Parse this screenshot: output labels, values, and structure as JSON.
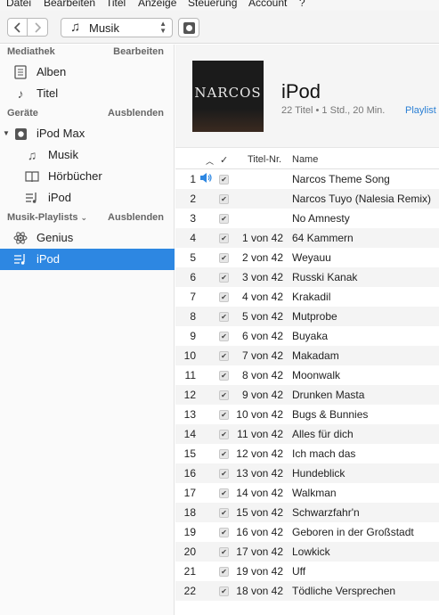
{
  "menu": [
    "Datei",
    "Bearbeiten",
    "Titel",
    "Anzeige",
    "Steuerung",
    "Account",
    "?"
  ],
  "toolbar": {
    "media_type": "Musik"
  },
  "sidebar": {
    "library_title": "Mediathek",
    "library_action": "Bearbeiten",
    "library_items": [
      {
        "label": "Alben",
        "icon": "album-icon"
      },
      {
        "label": "Titel",
        "icon": "music-note-icon"
      }
    ],
    "devices_title": "Geräte",
    "devices_action": "Ausblenden",
    "device_name": "iPod Max",
    "device_items": [
      {
        "label": "Musik",
        "icon": "music-note-icon"
      },
      {
        "label": "Hörbücher",
        "icon": "book-icon"
      },
      {
        "label": "iPod",
        "icon": "playlist-icon"
      }
    ],
    "playlists_title": "Musik-Playlists",
    "playlists_action": "Ausblenden",
    "playlist_items": [
      {
        "label": "Genius",
        "icon": "genius-atom-icon"
      },
      {
        "label": "iPod",
        "icon": "playlist-icon",
        "selected": true
      }
    ]
  },
  "header": {
    "cover_text": "NARCOS",
    "title": "iPod",
    "subtitle": "22 Titel • 1 Std., 20 Min.",
    "link": "Playlist"
  },
  "table": {
    "col_check": "✓",
    "col_track_nr": "Titel-Nr.",
    "col_name": "Name",
    "rows": [
      {
        "n": "1",
        "nr": "",
        "name": "Narcos Theme Song",
        "playing": true
      },
      {
        "n": "2",
        "nr": "",
        "name": "Narcos Tuyo (Nalesia Remix)"
      },
      {
        "n": "3",
        "nr": "",
        "name": "No Amnesty"
      },
      {
        "n": "4",
        "nr": "1 von 42",
        "name": "64 Kammern"
      },
      {
        "n": "5",
        "nr": "2 von 42",
        "name": "Weyauu"
      },
      {
        "n": "6",
        "nr": "3 von 42",
        "name": "Russki Kanak"
      },
      {
        "n": "7",
        "nr": "4 von 42",
        "name": "Krakadil"
      },
      {
        "n": "8",
        "nr": "5 von 42",
        "name": "Mutprobe"
      },
      {
        "n": "9",
        "nr": "6 von 42",
        "name": "Buyaka"
      },
      {
        "n": "10",
        "nr": "7 von 42",
        "name": "Makadam"
      },
      {
        "n": "11",
        "nr": "8 von 42",
        "name": "Moonwalk"
      },
      {
        "n": "12",
        "nr": "9 von 42",
        "name": "Drunken Masta"
      },
      {
        "n": "13",
        "nr": "10 von 42",
        "name": "Bugs & Bunnies"
      },
      {
        "n": "14",
        "nr": "11 von 42",
        "name": "Alles für dich"
      },
      {
        "n": "15",
        "nr": "12 von 42",
        "name": "Ich mach das"
      },
      {
        "n": "16",
        "nr": "13 von 42",
        "name": "Hundeblick"
      },
      {
        "n": "17",
        "nr": "14 von 42",
        "name": "Walkman"
      },
      {
        "n": "18",
        "nr": "15 von 42",
        "name": "Schwarzfahr'n"
      },
      {
        "n": "19",
        "nr": "16 von 42",
        "name": "Geboren in der Großstadt"
      },
      {
        "n": "20",
        "nr": "17 von 42",
        "name": "Lowkick"
      },
      {
        "n": "21",
        "nr": "19 von 42",
        "name": "Uff"
      },
      {
        "n": "22",
        "nr": "18 von 42",
        "name": "Tödliche Versprechen"
      }
    ]
  }
}
